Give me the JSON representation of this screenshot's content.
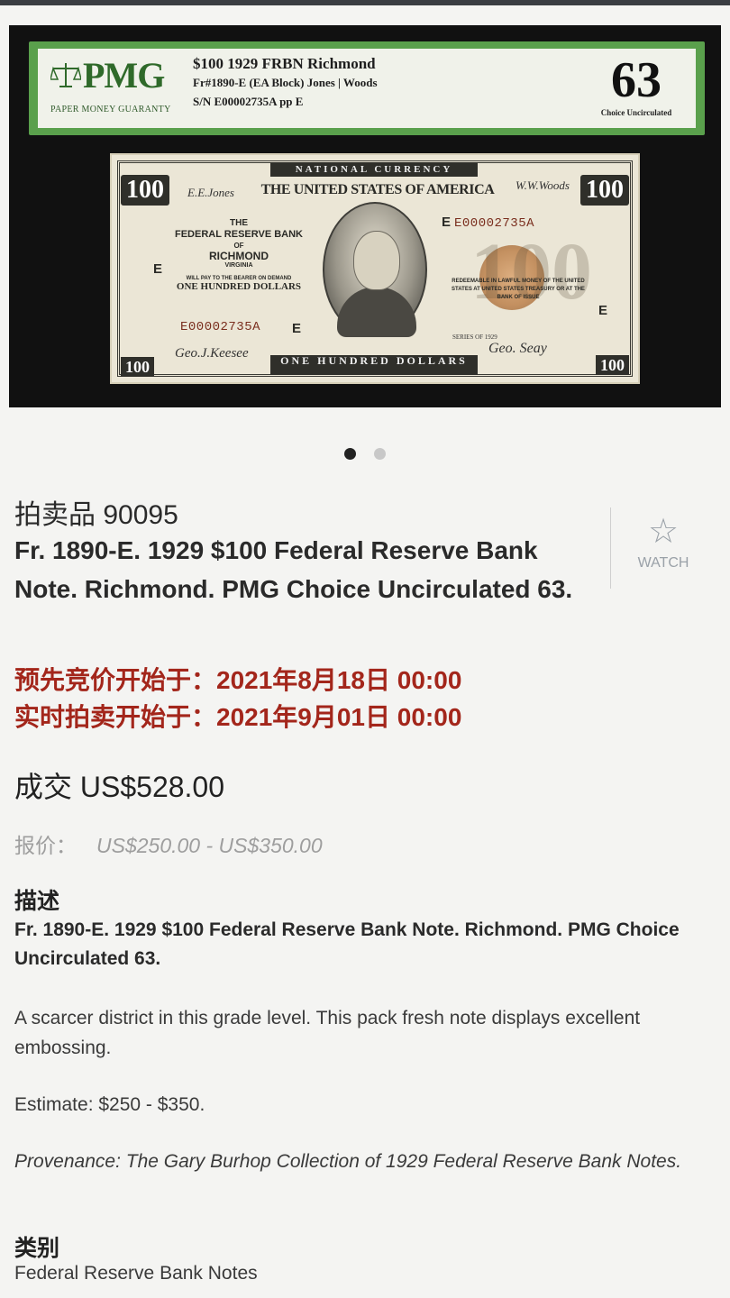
{
  "photo": {
    "label": {
      "brand": "PMG",
      "tagline": "PAPER MONEY GUARANTY",
      "line1": "$100 1929  FRBN Richmond",
      "line2": "Fr#1890-E (EA Block)  Jones | Woods",
      "line3": "S/N E00002735A pp E",
      "grade": "63",
      "grade_text": "Choice Uncirculated"
    },
    "note": {
      "header": "NATIONAL CURRENCY",
      "country": "THE UNITED STATES OF AMERICA",
      "bank_the": "THE",
      "bank_name": "FEDERAL RESERVE BANK",
      "bank_of": "OF",
      "bank_city": "RICHMOND",
      "bank_state": "VIRGINIA",
      "promise": "WILL PAY TO THE BEARER ON DEMAND",
      "amount": "ONE HUNDRED DOLLARS",
      "serial": "E00002735A",
      "district_letter": "E",
      "denomination": "100",
      "band": "ONE HUNDRED DOLLARS",
      "redeem": "REDEEMABLE IN LAWFUL MONEY OF THE UNITED STATES AT UNITED STATES TREASURY OR AT THE BANK OF ISSUE",
      "series": "SERIES OF 1929"
    }
  },
  "carousel": {
    "total": 2,
    "active": 1
  },
  "lot": {
    "label": "拍卖品 90095"
  },
  "title": "Fr. 1890-E. 1929 $100  Federal Reserve Bank Note. Richmond. PMG Choice Uncirculated 63.",
  "watch": {
    "label": "WATCH",
    "icon": "star-outline-icon"
  },
  "dates": {
    "prebid": "预先竞价开始于：2021年8月18日 00:00",
    "live": "实时拍卖开始于：2021年9月01日 00:00"
  },
  "sold": "成交 US$528.00",
  "estimate": {
    "label": "报价：",
    "value": "US$250.00 - US$350.00"
  },
  "description": {
    "heading": "描述",
    "title": "Fr. 1890-E. 1929 $100  Federal Reserve Bank Note. Richmond. PMG Choice Uncirculated 63.",
    "para1": "A scarcer district in this grade level. This pack fresh note displays excellent embossing.",
    "para2": "Estimate: $250 - $350.",
    "para3": "Provenance: The Gary Burhop Collection of 1929 Federal Reserve Bank Notes."
  },
  "category": {
    "heading": "类别",
    "value": "Federal Reserve Bank Notes"
  },
  "colors": {
    "accent_red": "#a3261b",
    "muted": "#9e9e9e",
    "label_green": "#5aa04c"
  }
}
